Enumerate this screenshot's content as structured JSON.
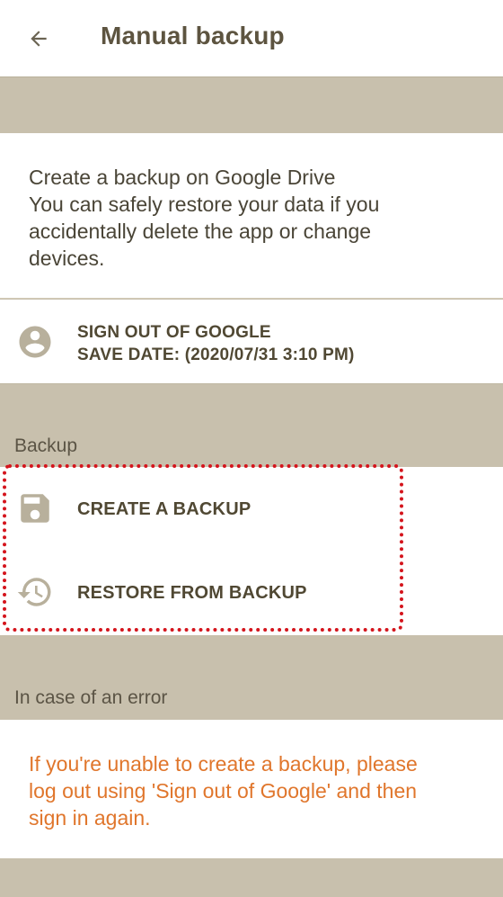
{
  "header": {
    "title": "Manual backup",
    "back_icon": "arrow-back-icon"
  },
  "intro": {
    "lines": [
      "Create a backup on Google Drive",
      "You can safely restore your data if you",
      "accidentally delete the app or change",
      "devices."
    ]
  },
  "account": {
    "icon": "account-circle-icon",
    "sign_out_label": "SIGN OUT OF GOOGLE",
    "save_date_label": "SAVE DATE: (2020/07/31 3:10 PM)"
  },
  "backup_section": {
    "heading": "Backup",
    "items": [
      {
        "label": "CREATE A BACKUP",
        "icon": "save-icon"
      },
      {
        "label": "RESTORE FROM BACKUP",
        "icon": "restore-history-icon"
      }
    ]
  },
  "error_section": {
    "heading": "In case of an error",
    "lines": [
      "If you're unable to create a backup, please",
      "log out using 'Sign out of Google' and then",
      "sign in again."
    ]
  },
  "colors": {
    "background": "#c8c0ad",
    "title_text": "#5d5440",
    "warning_text": "#e0762c",
    "highlight_border": "#d4141c",
    "icon": "#b8b09c"
  }
}
